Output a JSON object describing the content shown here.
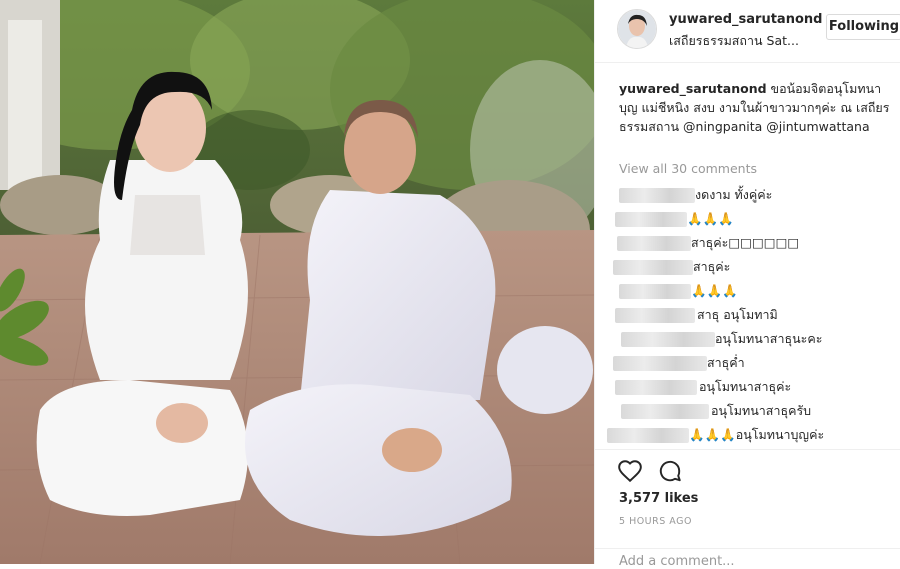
{
  "post": {
    "username": "yuwared_sarutanond",
    "location": "เสถียรธรรมสถาน Sat...",
    "follow_label": "Following",
    "caption_user": "yuwared_sarutanond",
    "caption_text": " ขอน้อมจิตอนุโมทนาบุญ แม่ชีหนิง สงบ งามในผ้าขาวมากๆค่ะ ณ เสถียรธรรมสถาน @ningpanita @jintumwattana",
    "view_all": "View all 30 comments",
    "likes": "3,577 likes",
    "time": "5 HOURS AGO",
    "add_comment": "Add a comment...",
    "icons": {
      "like": "heart-icon",
      "comment": "comment-bubble-icon"
    }
  },
  "comments": [
    {
      "text": "งดงาม ทั้งคู่ค่ะ"
    },
    {
      "text": "🙏🙏🙏"
    },
    {
      "text": "สาธุค่ะ□□□□□□"
    },
    {
      "text": "สาธุค่ะ"
    },
    {
      "text": "🙏🙏🙏"
    },
    {
      "text": "สาธุ อนุโมทามิ"
    },
    {
      "text": "อนุโมทนาสาธุนะคะ"
    },
    {
      "text": "สาธุค่ำ"
    },
    {
      "text": "อนุโมทนาสาธุค่ะ"
    },
    {
      "text": "อนุโมทนาสาธุครับ"
    },
    {
      "text": "🙏🙏🙏อนุโมทนาบุญค่ะ"
    }
  ]
}
